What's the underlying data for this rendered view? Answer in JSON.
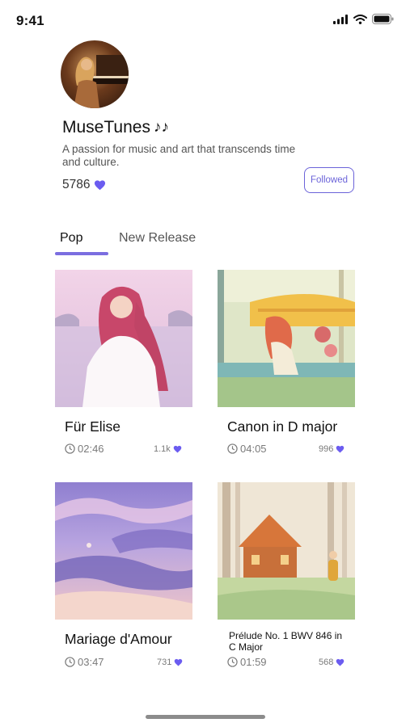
{
  "status_bar": {
    "time": "9:41"
  },
  "profile": {
    "name": "MuseTunes",
    "bio": "A passion for music and art that transcends time and culture.",
    "likes": "5786",
    "follow_label": "Followed"
  },
  "tabs": [
    {
      "label": "Pop",
      "active": true
    },
    {
      "label": "New Release",
      "active": false
    }
  ],
  "tracks": [
    {
      "title": "Für Elise",
      "duration": "02:46",
      "likes": "1.1k"
    },
    {
      "title": "Canon in D major",
      "duration": "04:05",
      "likes": "996"
    },
    {
      "title": "Mariage d'Amour",
      "duration": "03:47",
      "likes": "731"
    },
    {
      "title": "Prélude No. 1 BWV 846 in C Major",
      "duration": "01:59",
      "likes": "568"
    }
  ],
  "colors": {
    "accent": "#6b63d9",
    "heart": "#6b5cf0",
    "tab_indicator": "#7b6ee0"
  },
  "icons": [
    "signal-icon",
    "wifi-icon",
    "battery-icon",
    "music-note-icon",
    "heart-icon",
    "clock-icon"
  ]
}
